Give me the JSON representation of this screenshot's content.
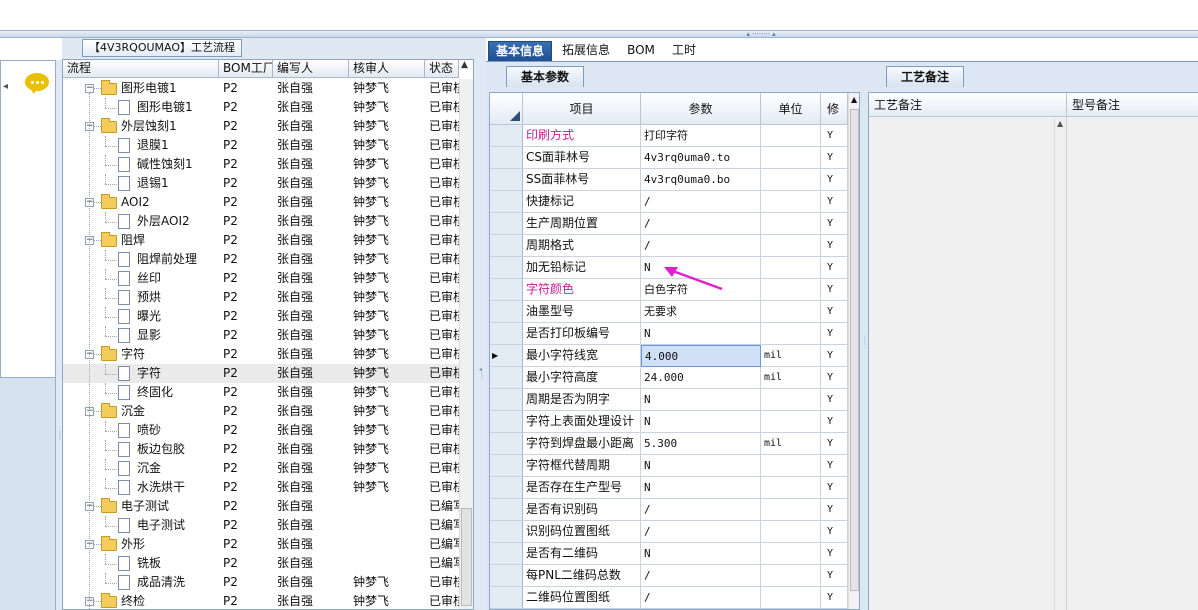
{
  "tree_panel": {
    "title": "【4V3RQOUMAO】工艺流程",
    "columns": [
      "流程",
      "BOM工厂",
      "编写人",
      "核审人",
      "状态"
    ],
    "rows": [
      {
        "name": "图形电镀1",
        "level": 0,
        "expanded": true,
        "bom": "P2",
        "writer": "张自强",
        "reviewer": "钟梦飞",
        "status": "已审核"
      },
      {
        "name": "图形电镀1",
        "level": 1,
        "bom": "P2",
        "writer": "张自强",
        "reviewer": "钟梦飞",
        "status": "已审核"
      },
      {
        "name": "外层蚀刻1",
        "level": 0,
        "expanded": true,
        "bom": "P2",
        "writer": "张自强",
        "reviewer": "钟梦飞",
        "status": "已审核"
      },
      {
        "name": "退膜1",
        "level": 1,
        "bom": "P2",
        "writer": "张自强",
        "reviewer": "钟梦飞",
        "status": "已审核"
      },
      {
        "name": "碱性蚀刻1",
        "level": 1,
        "bom": "P2",
        "writer": "张自强",
        "reviewer": "钟梦飞",
        "status": "已审核"
      },
      {
        "name": "退锡1",
        "level": 1,
        "bom": "P2",
        "writer": "张自强",
        "reviewer": "钟梦飞",
        "status": "已审核"
      },
      {
        "name": "AOI2",
        "level": 0,
        "expanded": true,
        "bom": "P2",
        "writer": "张自强",
        "reviewer": "钟梦飞",
        "status": "已审核"
      },
      {
        "name": "外层AOI2",
        "level": 1,
        "bom": "P2",
        "writer": "张自强",
        "reviewer": "钟梦飞",
        "status": "已审核"
      },
      {
        "name": "阻焊",
        "level": 0,
        "expanded": true,
        "bom": "P2",
        "writer": "张自强",
        "reviewer": "钟梦飞",
        "status": "已审核"
      },
      {
        "name": "阻焊前处理",
        "level": 1,
        "bom": "P2",
        "writer": "张自强",
        "reviewer": "钟梦飞",
        "status": "已审核"
      },
      {
        "name": "丝印",
        "level": 1,
        "bom": "P2",
        "writer": "张自强",
        "reviewer": "钟梦飞",
        "status": "已审核"
      },
      {
        "name": "预烘",
        "level": 1,
        "bom": "P2",
        "writer": "张自强",
        "reviewer": "钟梦飞",
        "status": "已审核"
      },
      {
        "name": "曝光",
        "level": 1,
        "bom": "P2",
        "writer": "张自强",
        "reviewer": "钟梦飞",
        "status": "已审核"
      },
      {
        "name": "显影",
        "level": 1,
        "bom": "P2",
        "writer": "张自强",
        "reviewer": "钟梦飞",
        "status": "已审核"
      },
      {
        "name": "字符",
        "level": 0,
        "expanded": true,
        "bom": "P2",
        "writer": "张自强",
        "reviewer": "钟梦飞",
        "status": "已审核"
      },
      {
        "name": "字符",
        "level": 1,
        "selected": true,
        "bom": "P2",
        "writer": "张自强",
        "reviewer": "钟梦飞",
        "status": "已审核"
      },
      {
        "name": "终固化",
        "level": 1,
        "bom": "P2",
        "writer": "张自强",
        "reviewer": "钟梦飞",
        "status": "已审核"
      },
      {
        "name": "沉金",
        "level": 0,
        "expanded": true,
        "bom": "P2",
        "writer": "张自强",
        "reviewer": "钟梦飞",
        "status": "已审核"
      },
      {
        "name": "喷砂",
        "level": 1,
        "bom": "P2",
        "writer": "张自强",
        "reviewer": "钟梦飞",
        "status": "已审核"
      },
      {
        "name": "板边包胶",
        "level": 1,
        "bom": "P2",
        "writer": "张自强",
        "reviewer": "钟梦飞",
        "status": "已审核"
      },
      {
        "name": "沉金",
        "level": 1,
        "bom": "P2",
        "writer": "张自强",
        "reviewer": "钟梦飞",
        "status": "已审核"
      },
      {
        "name": "水洗烘干",
        "level": 1,
        "bom": "P2",
        "writer": "张自强",
        "reviewer": "钟梦飞",
        "status": "已审核"
      },
      {
        "name": "电子测试",
        "level": 0,
        "expanded": true,
        "bom": "P2",
        "writer": "张自强",
        "reviewer": "",
        "status": "已编写"
      },
      {
        "name": "电子测试",
        "level": 1,
        "bom": "P2",
        "writer": "张自强",
        "reviewer": "",
        "status": "已编写"
      },
      {
        "name": "外形",
        "level": 0,
        "expanded": true,
        "bom": "P2",
        "writer": "张自强",
        "reviewer": "",
        "status": "已编写"
      },
      {
        "name": "铣板",
        "level": 1,
        "bom": "P2",
        "writer": "张自强",
        "reviewer": "",
        "status": "已编写"
      },
      {
        "name": "成品清洗",
        "level": 1,
        "bom": "P2",
        "writer": "张自强",
        "reviewer": "钟梦飞",
        "status": "已审核"
      },
      {
        "name": "终检",
        "level": 0,
        "expanded": true,
        "bom": "P2",
        "writer": "张自强",
        "reviewer": "钟梦飞",
        "status": "已审核"
      }
    ]
  },
  "tabs": [
    "基本信息",
    "拓展信息",
    "BOM",
    "工时"
  ],
  "active_tab": "基本信息",
  "basic_params": {
    "subtab": "基本参数",
    "columns": [
      "项目",
      "参数",
      "单位",
      "修"
    ],
    "rows": [
      {
        "item": "印刷方式",
        "value": "打印字符",
        "unit": "",
        "flag": "Y",
        "highlight": true
      },
      {
        "item": "CS面菲林号",
        "value": "4v3rq0uma0.to",
        "unit": "",
        "flag": "Y"
      },
      {
        "item": "SS面菲林号",
        "value": "4v3rq0uma0.bo",
        "unit": "",
        "flag": "Y"
      },
      {
        "item": "快捷标记",
        "value": "/",
        "unit": "",
        "flag": "Y"
      },
      {
        "item": "生产周期位置",
        "value": "/",
        "unit": "",
        "flag": "Y"
      },
      {
        "item": "周期格式",
        "value": "/",
        "unit": "",
        "flag": "Y"
      },
      {
        "item": "加无铅标记",
        "value": "N",
        "unit": "",
        "flag": "Y"
      },
      {
        "item": "字符颜色",
        "value": "白色字符",
        "unit": "",
        "flag": "Y",
        "highlight": true
      },
      {
        "item": "油墨型号",
        "value": "无要求",
        "unit": "",
        "flag": "Y"
      },
      {
        "item": "是否打印板编号",
        "value": "N",
        "unit": "",
        "flag": "Y"
      },
      {
        "item": "最小字符线宽",
        "value": "4.000",
        "unit": "mil",
        "flag": "Y",
        "current": true
      },
      {
        "item": "最小字符高度",
        "value": "24.000",
        "unit": "mil",
        "flag": "Y"
      },
      {
        "item": "周期是否为阴字",
        "value": "N",
        "unit": "",
        "flag": "Y"
      },
      {
        "item": "字符上表面处理设计",
        "value": "N",
        "unit": "",
        "flag": "Y"
      },
      {
        "item": "字符到焊盘最小距离",
        "value": "5.300",
        "unit": "mil",
        "flag": "Y"
      },
      {
        "item": "字符框代替周期",
        "value": "N",
        "unit": "",
        "flag": "Y"
      },
      {
        "item": "是否存在生产型号",
        "value": "N",
        "unit": "",
        "flag": "Y"
      },
      {
        "item": "是否有识别码",
        "value": "/",
        "unit": "",
        "flag": "Y"
      },
      {
        "item": "识别码位置图纸",
        "value": "/",
        "unit": "",
        "flag": "Y"
      },
      {
        "item": "是否有二维码",
        "value": "N",
        "unit": "",
        "flag": "Y"
      },
      {
        "item": "每PNL二维码总数",
        "value": "/",
        "unit": "",
        "flag": "Y"
      },
      {
        "item": "二维码位置图纸",
        "value": "/",
        "unit": "",
        "flag": "Y"
      }
    ]
  },
  "process_notes": {
    "subtab": "工艺备注",
    "columns": [
      "工艺备注",
      "型号备注"
    ]
  },
  "colors": {
    "highlight_text": "#c0209a",
    "arrow": "#e020d0",
    "active_tab": "#2a5ea2"
  }
}
